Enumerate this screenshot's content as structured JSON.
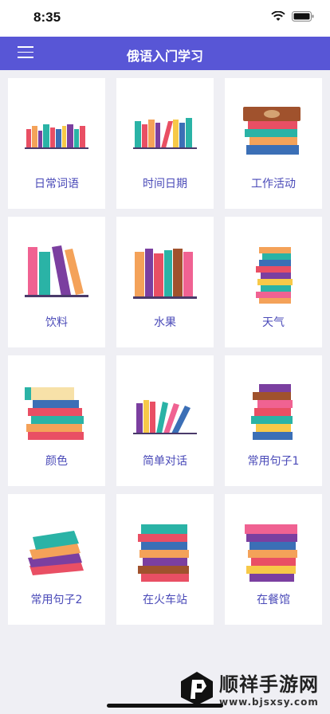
{
  "status_bar": {
    "time": "8:35",
    "wifi_icon": "wifi-icon",
    "battery_icon": "battery-icon"
  },
  "nav": {
    "title": "俄语入门学习",
    "menu_icon": "hamburger-menu-icon"
  },
  "categories": [
    {
      "label": "日常词语",
      "icon": "books-row-icon"
    },
    {
      "label": "时间日期",
      "icon": "books-row-icon"
    },
    {
      "label": "工作活动",
      "icon": "book-stack-icon"
    },
    {
      "label": "饮料",
      "icon": "books-leaning-icon"
    },
    {
      "label": "水果",
      "icon": "books-row-icon"
    },
    {
      "label": "天气",
      "icon": "book-stack-icon"
    },
    {
      "label": "颜色",
      "icon": "book-stack-icon"
    },
    {
      "label": "简单对话",
      "icon": "books-leaning-icon"
    },
    {
      "label": "常用句子1",
      "icon": "book-stack-icon"
    },
    {
      "label": "常用句子2",
      "icon": "book-stack-icon"
    },
    {
      "label": "在火车站",
      "icon": "book-stack-icon"
    },
    {
      "label": "在餐馆",
      "icon": "book-stack-icon"
    }
  ],
  "watermark": {
    "title": "顺祥手游网",
    "url": "www.bjsxsy.com"
  }
}
